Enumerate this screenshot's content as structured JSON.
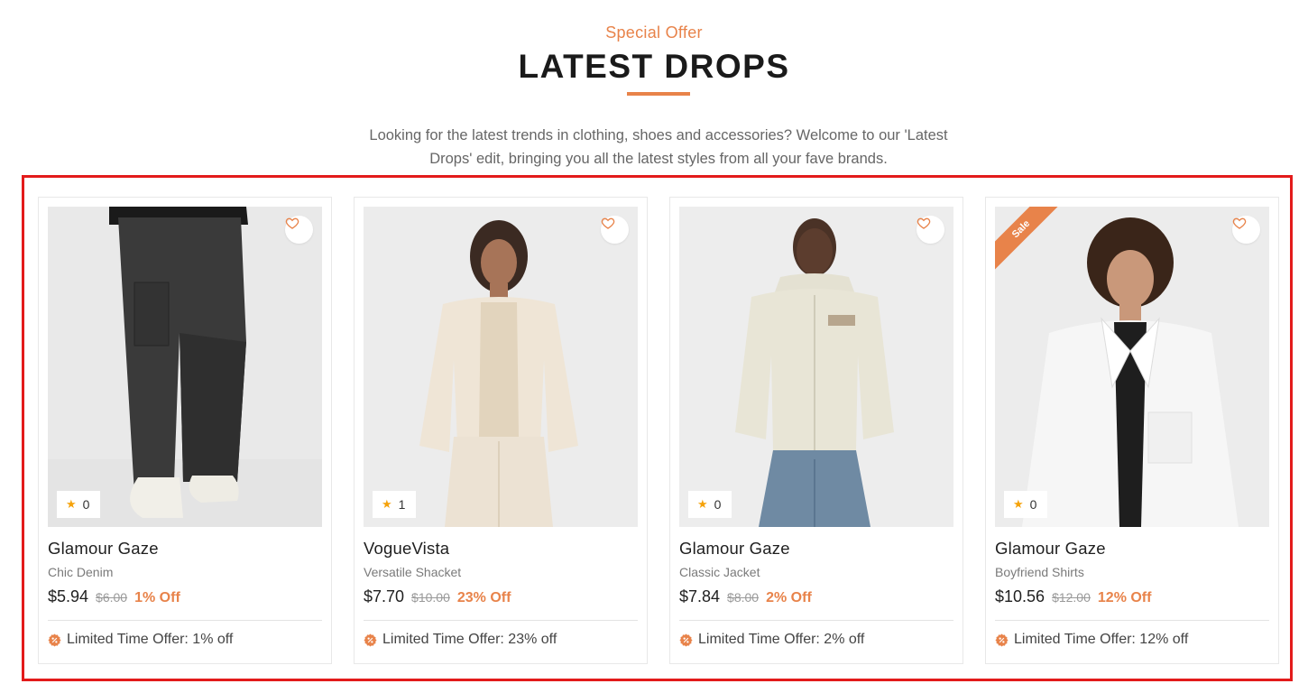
{
  "section": {
    "eyebrow": "Special Offer",
    "title": "LATEST DROPS",
    "description": "Looking for the latest trends in clothing, shoes and accessories? Welcome to our 'Latest Drops' edit, bringing you all the latest styles from all your fave brands."
  },
  "colors": {
    "accent": "#e8834a",
    "highlight": "#e31b1b",
    "star": "#f5a20a"
  },
  "products": [
    {
      "brand": "Glamour Gaze",
      "name": "Chic Denim",
      "price": "$5.94",
      "old_price": "$6.00",
      "discount": "1% Off",
      "rating": "0",
      "offer": "Limited Time Offer: 1% off",
      "sale_label": ""
    },
    {
      "brand": "VogueVista",
      "name": "Versatile Shacket",
      "price": "$7.70",
      "old_price": "$10.00",
      "discount": "23% Off",
      "rating": "1",
      "offer": "Limited Time Offer: 23% off",
      "sale_label": ""
    },
    {
      "brand": "Glamour Gaze",
      "name": "Classic Jacket",
      "price": "$7.84",
      "old_price": "$8.00",
      "discount": "2% Off",
      "rating": "0",
      "offer": "Limited Time Offer: 2% off",
      "sale_label": ""
    },
    {
      "brand": "Glamour Gaze",
      "name": "Boyfriend Shirts",
      "price": "$10.56",
      "old_price": "$12.00",
      "discount": "12% Off",
      "rating": "0",
      "offer": "Limited Time Offer: 12% off",
      "sale_label": "Sale"
    }
  ],
  "icons": {
    "wishlist": "heart-icon",
    "rating": "star-icon",
    "offer": "discount-badge-icon"
  }
}
